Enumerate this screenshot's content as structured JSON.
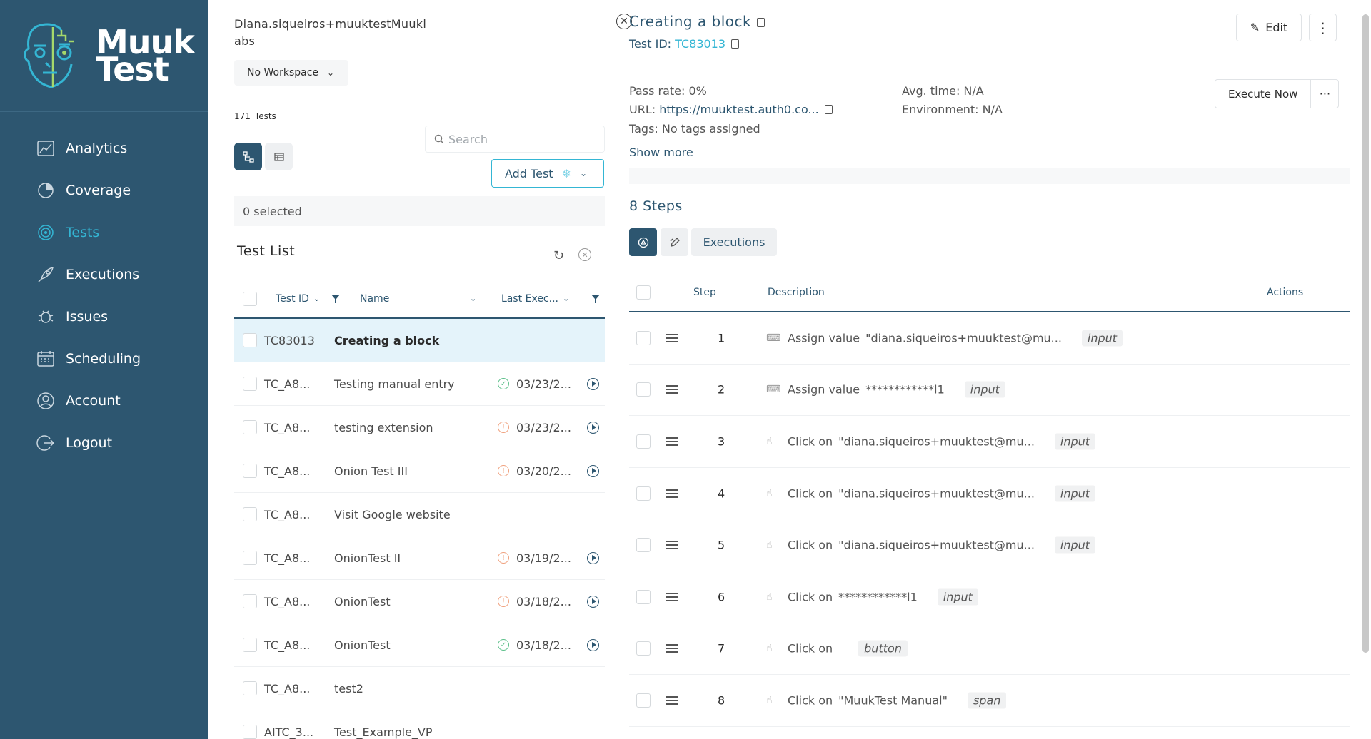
{
  "brand": {
    "line1": "Muuk",
    "line2": "Test"
  },
  "sidebar": {
    "items": [
      {
        "label": "Analytics",
        "icon": "analytics-icon"
      },
      {
        "label": "Coverage",
        "icon": "coverage-icon"
      },
      {
        "label": "Tests",
        "icon": "tests-icon",
        "active": true
      },
      {
        "label": "Executions",
        "icon": "rocket-icon"
      },
      {
        "label": "Issues",
        "icon": "bug-icon"
      },
      {
        "label": "Scheduling",
        "icon": "calendar-icon"
      },
      {
        "label": "Account",
        "icon": "user-icon"
      },
      {
        "label": "Logout",
        "icon": "logout-icon"
      }
    ]
  },
  "middle": {
    "user": "Diana.siqueiros+muuktestMuuklabs",
    "workspace": "No Workspace",
    "count_num": "171",
    "count_label": "Tests",
    "search_placeholder": "Search",
    "add_test": "Add Test",
    "selected": "0 selected",
    "list_title": "Test List",
    "columns": {
      "id": "Test ID",
      "name": "Name",
      "last": "Last Exec..."
    },
    "rows": [
      {
        "id": "TC83013",
        "name": "Creating a block",
        "status": "",
        "date": "",
        "play": false,
        "selected": true
      },
      {
        "id": "TC_A8...",
        "name": "Testing manual entry",
        "status": "ok",
        "date": "03/23/2...",
        "play": true
      },
      {
        "id": "TC_A8...",
        "name": "testing extension",
        "status": "warn",
        "date": "03/23/2...",
        "play": true
      },
      {
        "id": "TC_A8...",
        "name": "Onion Test III",
        "status": "warn",
        "date": "03/20/2...",
        "play": true
      },
      {
        "id": "TC_A8...",
        "name": "Visit Google website",
        "status": "",
        "date": "",
        "play": false
      },
      {
        "id": "TC_A8...",
        "name": "OnionTest II",
        "status": "warn",
        "date": "03/19/2...",
        "play": true
      },
      {
        "id": "TC_A8...",
        "name": "OnionTest",
        "status": "warn",
        "date": "03/18/2...",
        "play": true
      },
      {
        "id": "TC_A8...",
        "name": "OnionTest",
        "status": "ok",
        "date": "03/18/2...",
        "play": true
      },
      {
        "id": "TC_A8...",
        "name": "test2",
        "status": "",
        "date": "",
        "play": false
      },
      {
        "id": "AITC_3...",
        "name": "Test_Example_VP",
        "status": "",
        "date": "",
        "play": false
      }
    ]
  },
  "detail": {
    "title": "Creating a block",
    "test_id_label": "Test ID:",
    "test_id": "TC83013",
    "edit": "Edit",
    "pass_rate": "Pass rate: 0%",
    "url_label": "URL:",
    "url": "https://muuktest.auth0.co...",
    "tags": "Tags: No tags assigned",
    "avg_time": "Avg. time: N/A",
    "environment": "Environment: N/A",
    "show_more": "Show more",
    "execute_now": "Execute Now",
    "execute_more": "···",
    "steps_title": "8 Steps",
    "executions_tab": "Executions",
    "columns": {
      "step": "Step",
      "description": "Description",
      "actions": "Actions"
    },
    "steps": [
      {
        "num": "1",
        "action": "Assign value",
        "value": "\"diana.siqueiros+muuktest@mu...",
        "tag": "input",
        "kind": "keyboard"
      },
      {
        "num": "2",
        "action": "Assign value",
        "value": "************l1",
        "tag": "input",
        "kind": "keyboard"
      },
      {
        "num": "3",
        "action": "Click on",
        "value": "\"diana.siqueiros+muuktest@mu...",
        "tag": "input",
        "kind": "click"
      },
      {
        "num": "4",
        "action": "Click on",
        "value": "\"diana.siqueiros+muuktest@mu...",
        "tag": "input",
        "kind": "click"
      },
      {
        "num": "5",
        "action": "Click on",
        "value": "\"diana.siqueiros+muuktest@mu...",
        "tag": "input",
        "kind": "click"
      },
      {
        "num": "6",
        "action": "Click on",
        "value": "************l1",
        "tag": "input",
        "kind": "click"
      },
      {
        "num": "7",
        "action": "Click on",
        "value": "",
        "tag": "button",
        "kind": "click"
      },
      {
        "num": "8",
        "action": "Click on",
        "value": "\"MuukTest Manual\"",
        "tag": "span",
        "kind": "click"
      }
    ]
  },
  "colors": {
    "sidebar": "#2d5670",
    "accent": "#34b6d4",
    "selected_row": "#e4f3fa"
  }
}
